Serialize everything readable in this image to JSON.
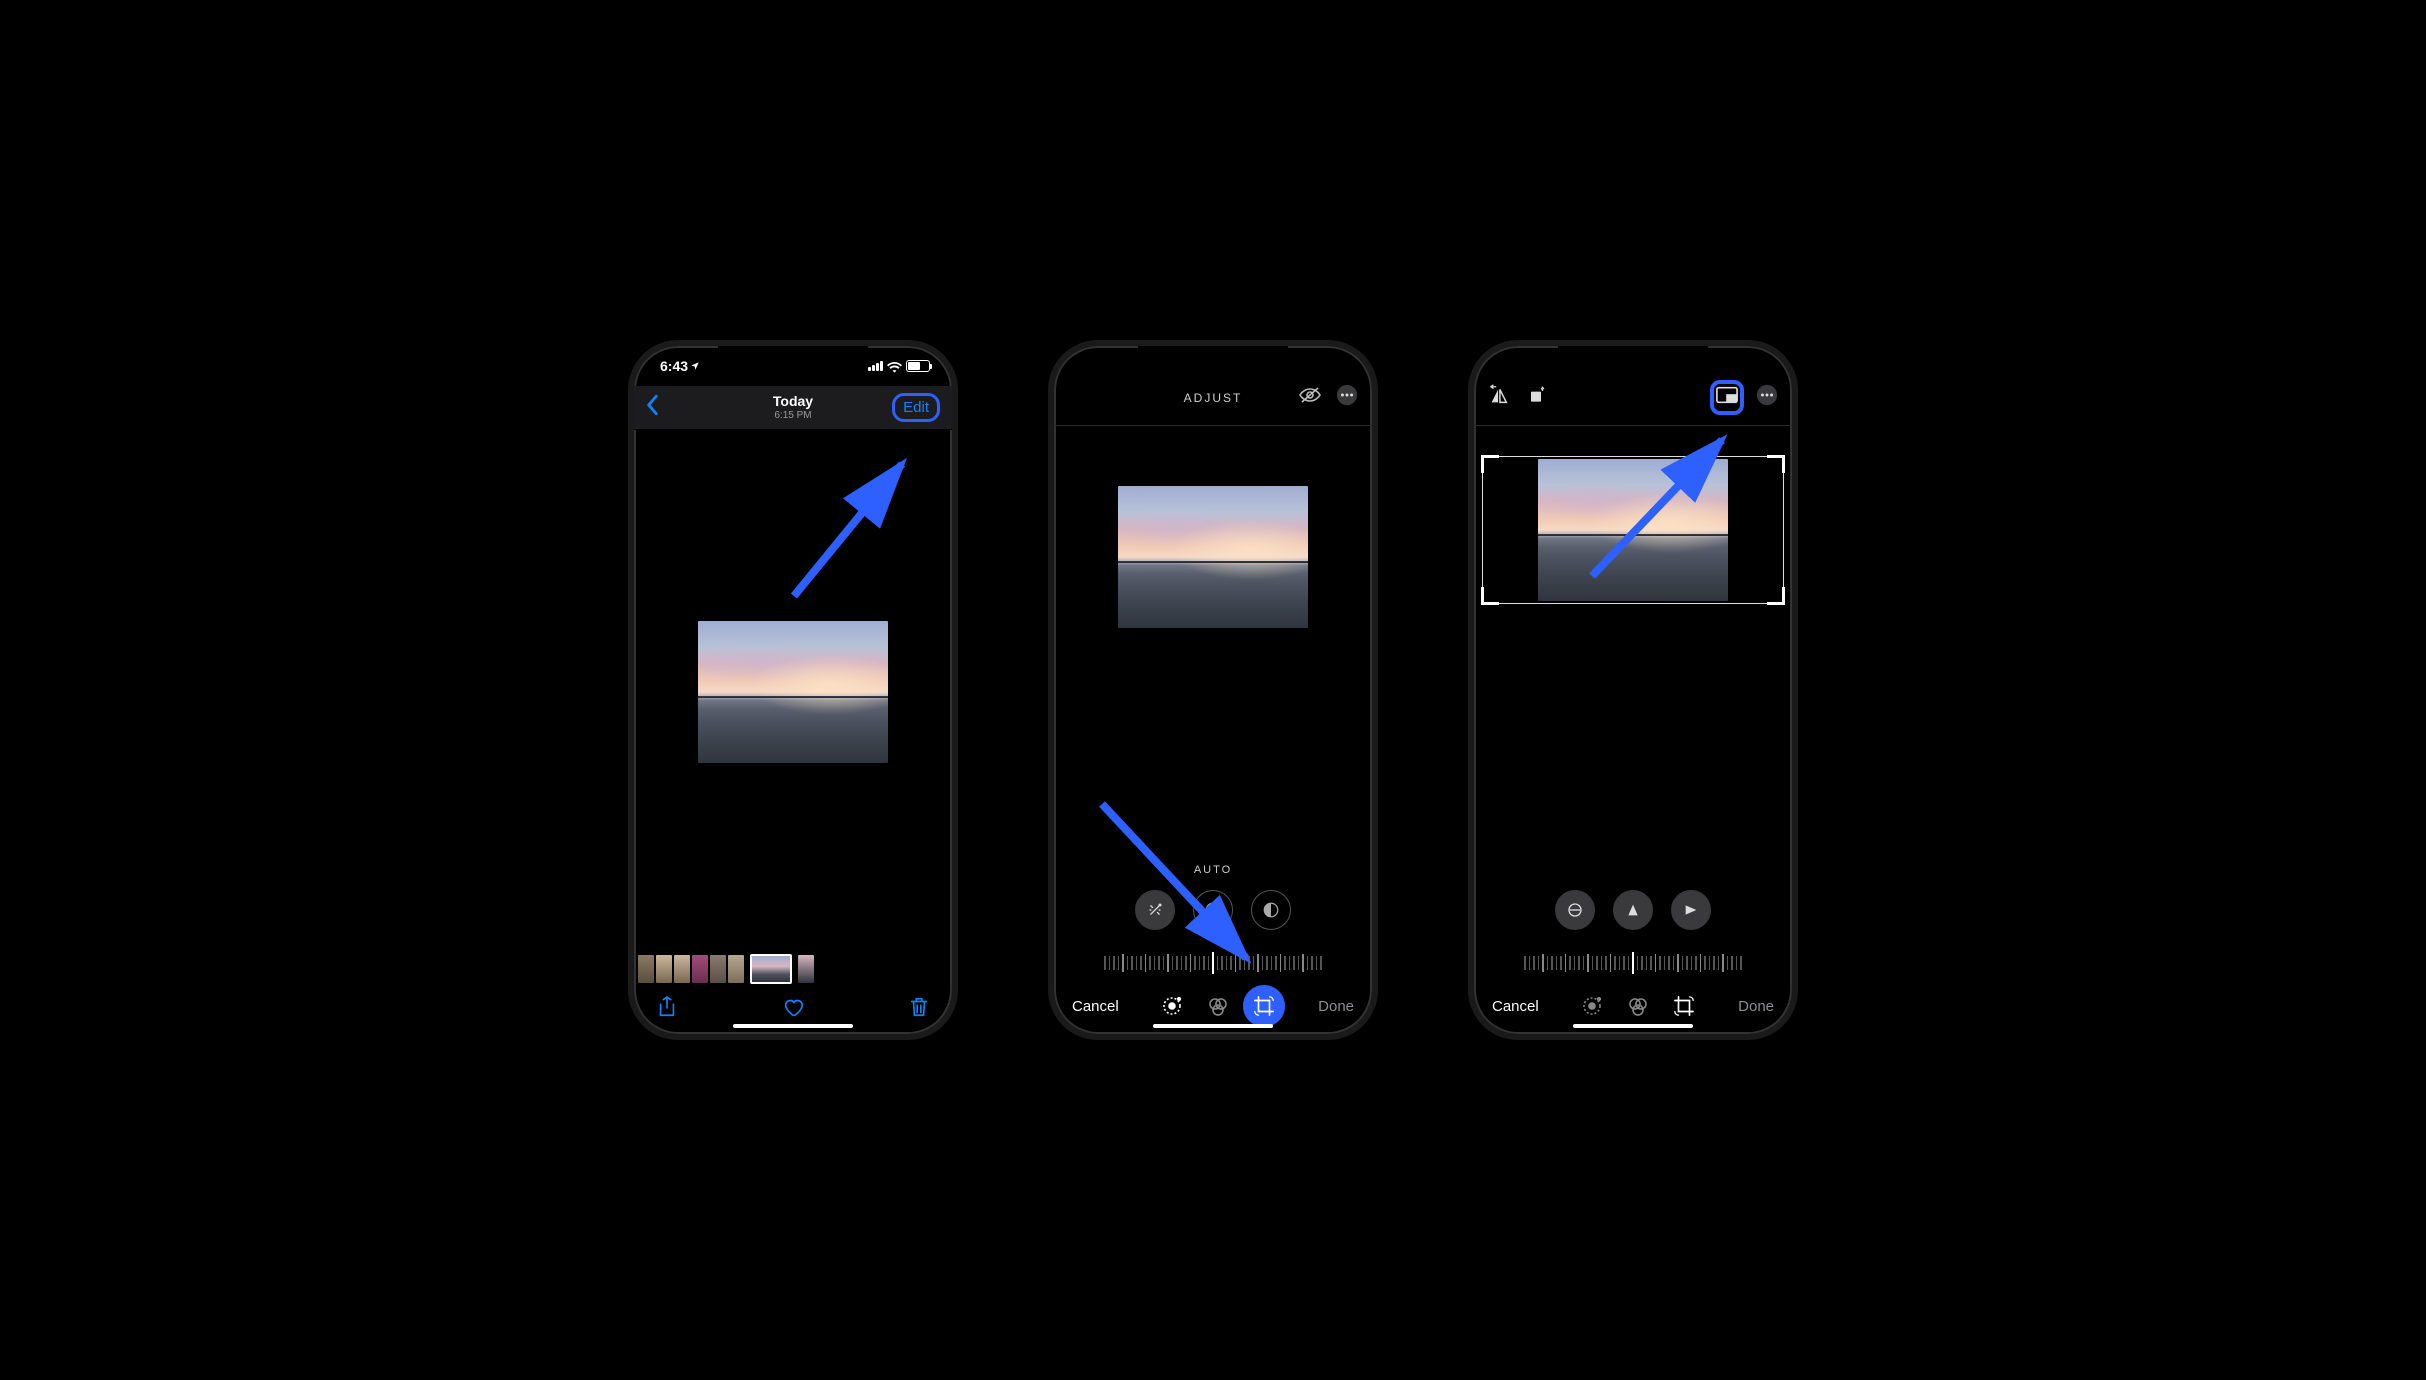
{
  "annotation_color": "#2e5fff",
  "phone1": {
    "status": {
      "time": "6:43"
    },
    "nav": {
      "title": "Today",
      "subtitle": "6:15 PM",
      "edit_label": "Edit"
    },
    "toolbar": {
      "share": "share-icon",
      "favorite": "heart-icon",
      "delete": "trash-icon"
    }
  },
  "phone2": {
    "header": {
      "title": "ADJUST",
      "visibility": "visibility-off-icon",
      "more": "more-icon"
    },
    "adjust_label": "AUTO",
    "bottom": {
      "cancel": "Cancel",
      "done": "Done"
    },
    "modes": {
      "adjust": "adjust-icon",
      "filters": "filters-icon",
      "crop": "crop-rotate-icon"
    }
  },
  "phone3": {
    "header": {
      "flip": "flip-icon",
      "rotate": "rotate-icon",
      "aspect": "aspect-ratio-icon",
      "more": "more-icon"
    },
    "bottom": {
      "cancel": "Cancel",
      "done": "Done"
    },
    "modes": {
      "adjust": "adjust-icon",
      "filters": "filters-icon",
      "crop": "crop-rotate-icon"
    }
  }
}
